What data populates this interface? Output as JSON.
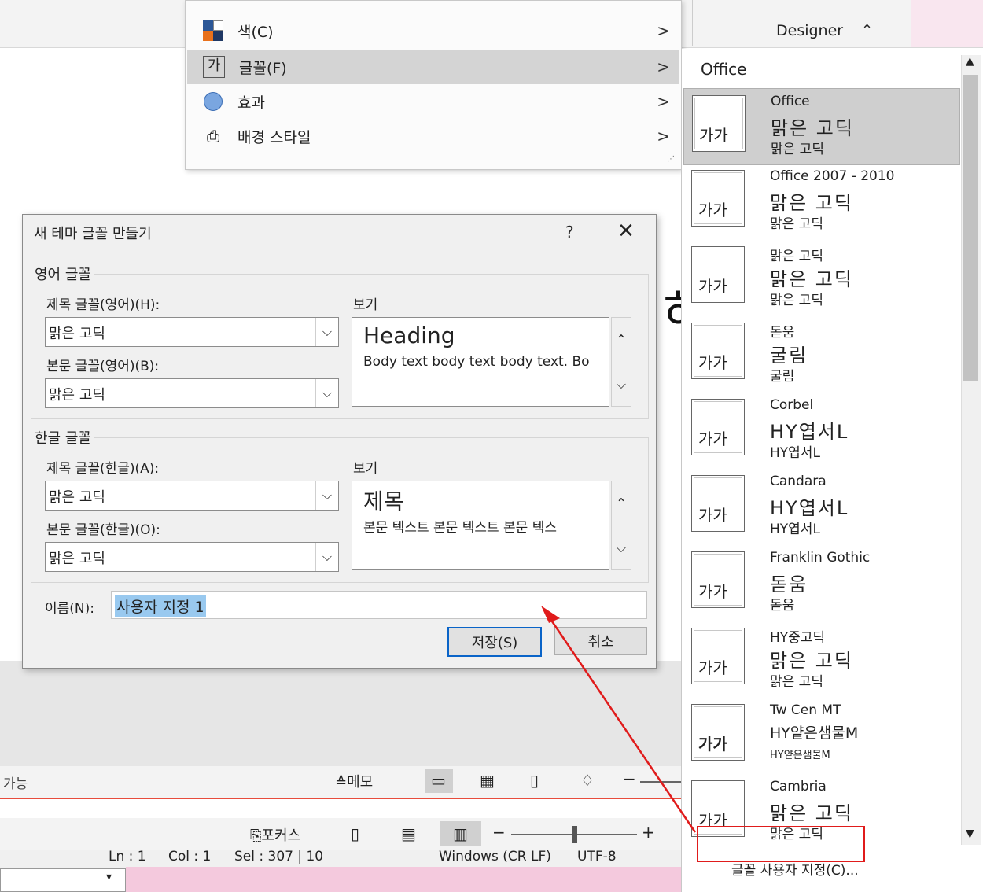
{
  "background": {
    "top_labels": [
      "Designer"
    ],
    "status_left_text": "가능",
    "memo_label": "메모",
    "focus_label": "포커스",
    "editor_status": {
      "ln": "Ln : 1",
      "col": "Col : 1",
      "sel": "Sel : 307 | 10",
      "eol": "Windows (CR LF)",
      "encoding": "UTF-8"
    },
    "big_glyph": "히"
  },
  "context_menu": {
    "items": [
      {
        "label": "색(C)",
        "icon": "color-palette-icon"
      },
      {
        "label": "글꼴(F)",
        "icon": "font-icon",
        "highlighted": true,
        "icon_text": "가"
      },
      {
        "label": "효과",
        "icon": "effects-icon"
      },
      {
        "label": "배경 스타일",
        "icon": "background-style-icon"
      }
    ],
    "arrow": ">"
  },
  "dialog": {
    "title": "새 테마 글꼴 만들기",
    "help": "?",
    "close": "✕",
    "latin_group": {
      "legend": "영어 글꼴",
      "heading_label": "제목 글꼴(영어)(H):",
      "heading_value": "맑은 고딕",
      "body_label": "본문 글꼴(영어)(B):",
      "body_value": "맑은 고딕",
      "preview_label": "보기",
      "preview_heading": "Heading",
      "preview_body": "Body text body text body text. Bo"
    },
    "hangul_group": {
      "legend": "한글 글꼴",
      "heading_label": "제목 글꼴(한글)(A):",
      "heading_value": "맑은 고딕",
      "body_label": "본문 글꼴(한글)(O):",
      "body_value": "맑은 고딕",
      "preview_label": "보기",
      "preview_heading": "제목",
      "preview_body": "본문 텍스트 본문 텍스트 본문 텍스"
    },
    "name_label": "이름(N):",
    "name_value": "사용자 지정 1",
    "save_label": "저장(S)",
    "cancel_label": "취소"
  },
  "font_panel": {
    "header": "Office",
    "items": [
      {
        "name": "Office",
        "heading": "맑은 고딕",
        "body": "맑은 고딕",
        "thumb": "가가",
        "selected": true
      },
      {
        "name": "Office 2007 - 2010",
        "heading": "맑은 고딕",
        "body": "맑은 고딕",
        "thumb": "가가"
      },
      {
        "name": "맑은 고딕",
        "heading": "맑은 고딕",
        "body": "맑은 고딕",
        "thumb": "가가"
      },
      {
        "name": "돋움",
        "heading": "굴림",
        "body": "굴림",
        "thumb": "가가"
      },
      {
        "name": "Corbel",
        "heading": "HY엽서L",
        "body": "HY엽서L",
        "thumb": "가가"
      },
      {
        "name": "Candara",
        "heading": "HY엽서L",
        "body": "HY엽서L",
        "thumb": "가가"
      },
      {
        "name": "Franklin Gothic",
        "heading": "돋움",
        "body": "돋움",
        "thumb": "가가"
      },
      {
        "name": "HY중고딕",
        "heading": "맑은 고딕",
        "body": "맑은 고딕",
        "thumb": "가가"
      },
      {
        "name": "Tw Cen MT",
        "heading": "HY얕은샘물M",
        "body": "HY얕은샘물M",
        "thumb": "가가"
      },
      {
        "name": "Cambria",
        "heading": "맑은 고딕",
        "body": "맑은 고딕",
        "thumb": "가가"
      }
    ],
    "customize_label": "글꼴 사용자 지정(C)..."
  },
  "colors": {
    "accent_blue": "#0a64c8",
    "annotation_red": "#e01b1b",
    "selection": "#99c9ef"
  }
}
